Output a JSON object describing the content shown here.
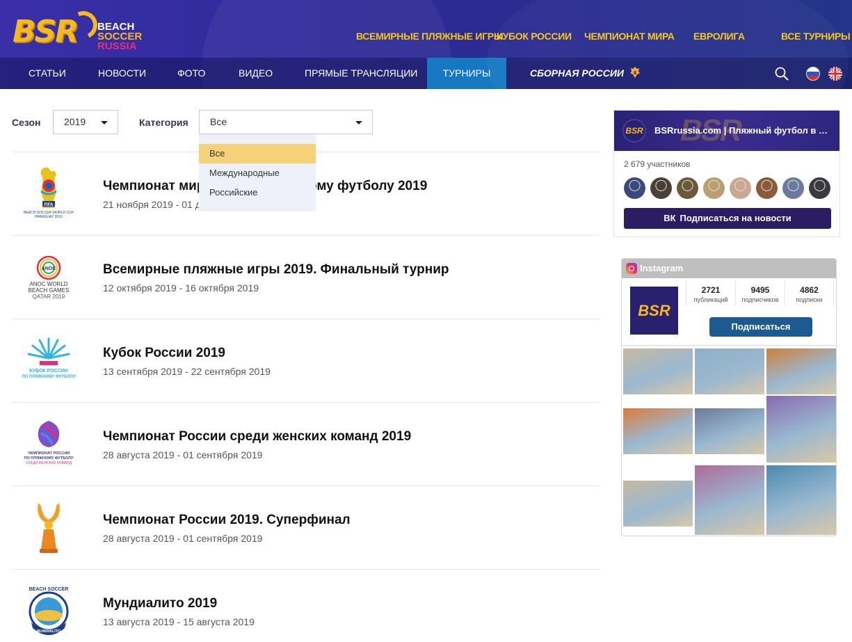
{
  "logo": {
    "mark": "BSR",
    "line1": "BEACH",
    "line2": "SOCCER",
    "line3": "RUSSIA"
  },
  "top_nav": [
    "ВСЕМИРНЫЕ ПЛЯЖНЫЕ ИГРЫ",
    "КУБОК РОССИИ",
    "ЧЕМПИОНАТ МИРА",
    "ЕВРОЛИГА",
    "ВСЕ ТУРНИРЫ"
  ],
  "main_nav": [
    "СТАТЬИ",
    "НОВОСТИ",
    "ФОТО",
    "ВИДЕО",
    "ПРЯМЫЕ ТРАНСЛЯЦИИ",
    "ТУРНИРЫ",
    "СБОРНАЯ РОССИИ"
  ],
  "icons": {
    "search": "search-icon",
    "flag_ru": "flag-ru-icon",
    "flag_en": "flag-uk-icon",
    "crest": "russia-crest-icon"
  },
  "filters": {
    "season_label": "Сезон",
    "season_value": "2019",
    "category_label": "Категория",
    "category_value": "Все",
    "category_options": [
      "Все",
      "Международные",
      "Российские"
    ]
  },
  "tournaments": [
    {
      "title": "Чемпионат мира FIFA по пляжному футболу 2019",
      "dates": "21 ноября 2019 - 01 декабря 2019",
      "logo_text": "BEACH SOCCER WORLD CUP PARAGUAY 2019"
    },
    {
      "title": "Всемирные пляжные игры 2019. Финальный турнир",
      "dates": "12 октября 2019 - 16 октября 2019",
      "logo_text": "ANOC WORLD BEACH GAMES QATAR 2019"
    },
    {
      "title": "Кубок России 2019",
      "dates": "13 сентября 2019 - 22 сентября 2019",
      "logo_text": "КУБОК РОССИИ ПО ПЛЯЖНОМУ ФУТБОЛУ"
    },
    {
      "title": "Чемпионат России среди женских команд 2019",
      "dates": "28 августа 2019 - 01 сентября 2019",
      "logo_text": "ЧЕМПИОНАТ РОССИИ ПО ПЛЯЖНОМУ ФУТБОЛУ СРЕДИ ЖЕНСКИХ КОМАНД"
    },
    {
      "title": "Чемпионат России 2019. Суперфинал",
      "dates": "28 августа 2019 - 01 сентября 2019",
      "logo_text": ""
    },
    {
      "title": "Мундиалито 2019",
      "dates": "13 августа 2019 - 15 августа 2019",
      "logo_text": "BEACH SOCCER MUNDIALITO"
    }
  ],
  "vk": {
    "group_name": "BSRrussia.com | Пляжный футбол в России",
    "members": "2 679 участников",
    "subscribe": "Подписаться на новости",
    "face_colors": [
      "#3a4a7a",
      "#4a4038",
      "#6b5a3a",
      "#b8a070",
      "#c8a890",
      "#8a5a3a",
      "#6a7aa0",
      "#3a3a40"
    ]
  },
  "instagram": {
    "title": "Instagram",
    "posts": "2721",
    "posts_label": "публикаций",
    "followers": "9495",
    "followers_label": "подписчиков",
    "following": "4862",
    "following_label": "подписки",
    "follow_button": "Подписаться",
    "tile_colors": [
      [
        "#c9b9a0",
        "#8fb0c8",
        "#d0803a"
      ],
      [
        "#e07a3a",
        "#6a7a9a",
        "#8a6ab0"
      ],
      [
        "#c8b8a0",
        "#b06a9a",
        "#4a8ab0"
      ]
    ]
  }
}
